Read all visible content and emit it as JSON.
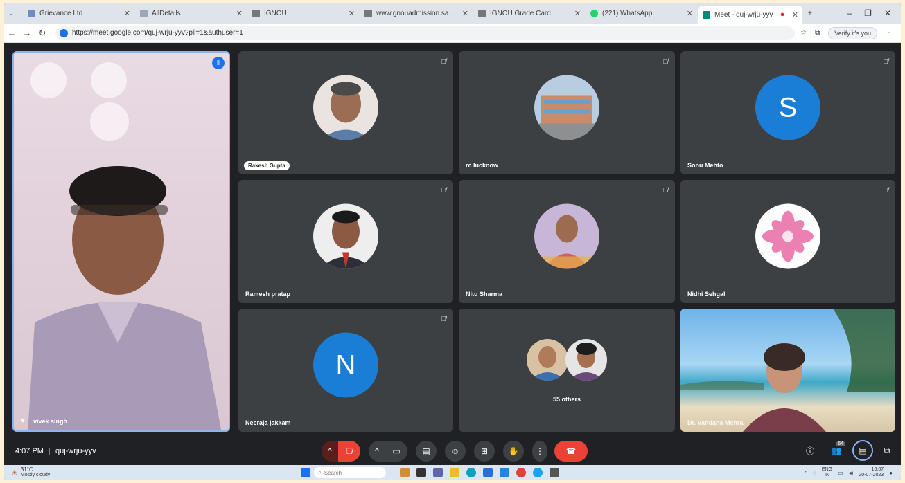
{
  "browser": {
    "tabs": [
      {
        "label": "Grievance Ltd",
        "color": "#6b8fc4"
      },
      {
        "label": "AllDetails",
        "color": "#9aa7b8"
      },
      {
        "label": "IGNOU",
        "color": "#777"
      },
      {
        "label": "www.gnouadmission.samarth.edu.in/changeaddress",
        "color": "#777"
      },
      {
        "label": "IGNOU Grade Card",
        "color": "#777"
      },
      {
        "label": "(221) WhatsApp",
        "color": "#25d366"
      },
      {
        "label": "Meet - quj-wrju-yyv",
        "color": "#00897b"
      }
    ],
    "url": "https://meet.google.com/quj-wrju-yyv?pli=1&authuser=1",
    "verify_label": "Verify it's you"
  },
  "meeting": {
    "time": "4:07 PM",
    "code": "quj-wrju-yyv",
    "participant_count": "64"
  },
  "participants": {
    "main": {
      "name": "vivek singh"
    },
    "rakesh": {
      "name": "Rakesh Gupta"
    },
    "rc": {
      "name": "rc lucknow"
    },
    "sonu": {
      "name": "Sonu Mehto",
      "initial": "S"
    },
    "ramesh": {
      "name": "Ramesh pratap"
    },
    "nitu": {
      "name": "Nitu Sharma"
    },
    "nidhi": {
      "name": "Nidhi Sehgal"
    },
    "neeraja": {
      "name": "Neeraja jakkam",
      "initial": "N"
    },
    "others": {
      "label": "55 others"
    },
    "presenter": {
      "name": "Dr. Vandana Mehra"
    }
  },
  "taskbar": {
    "weather_temp": "31°C",
    "weather_desc": "Mostly cloudy",
    "search_placeholder": "Search",
    "lang": "ENG",
    "region": "IN",
    "clock_time": "16:07",
    "clock_date": "20-07-2023"
  },
  "colors": {
    "end_call": "#ea4335",
    "mic_off": "#ea4335",
    "accent": "#1a73e8"
  }
}
